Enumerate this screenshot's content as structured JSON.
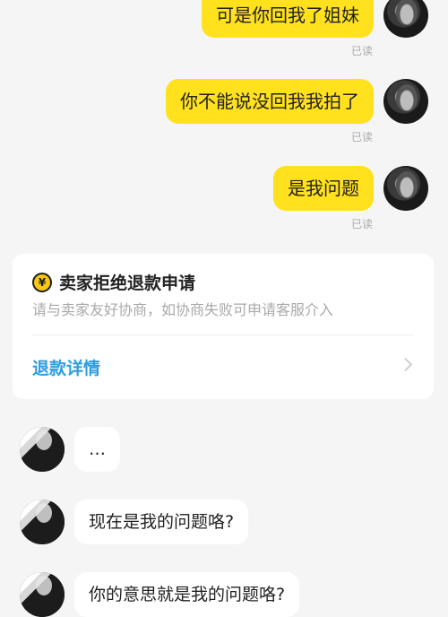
{
  "messages_sent": [
    {
      "text": "可是你回我了姐妹",
      "status": "已读"
    },
    {
      "text": "你不能说没回我我拍了",
      "status": "已读"
    },
    {
      "text": "是我问题",
      "status": "已读"
    }
  ],
  "refund_card": {
    "icon": "yen-coin-icon",
    "title": "卖家拒绝退款申请",
    "subtitle": "请与卖家友好协商，如协商失败可申请客服介入",
    "link_label": "退款详情"
  },
  "messages_received": [
    {
      "text": "…"
    },
    {
      "text": "现在是我的问题咯?"
    },
    {
      "text": "你的意思就是我的问题咯?"
    }
  ],
  "colors": {
    "bubble_sent": "#ffe11e",
    "bubble_received": "#ffffff",
    "link": "#2d9de0",
    "background": "#f5f5f5"
  }
}
